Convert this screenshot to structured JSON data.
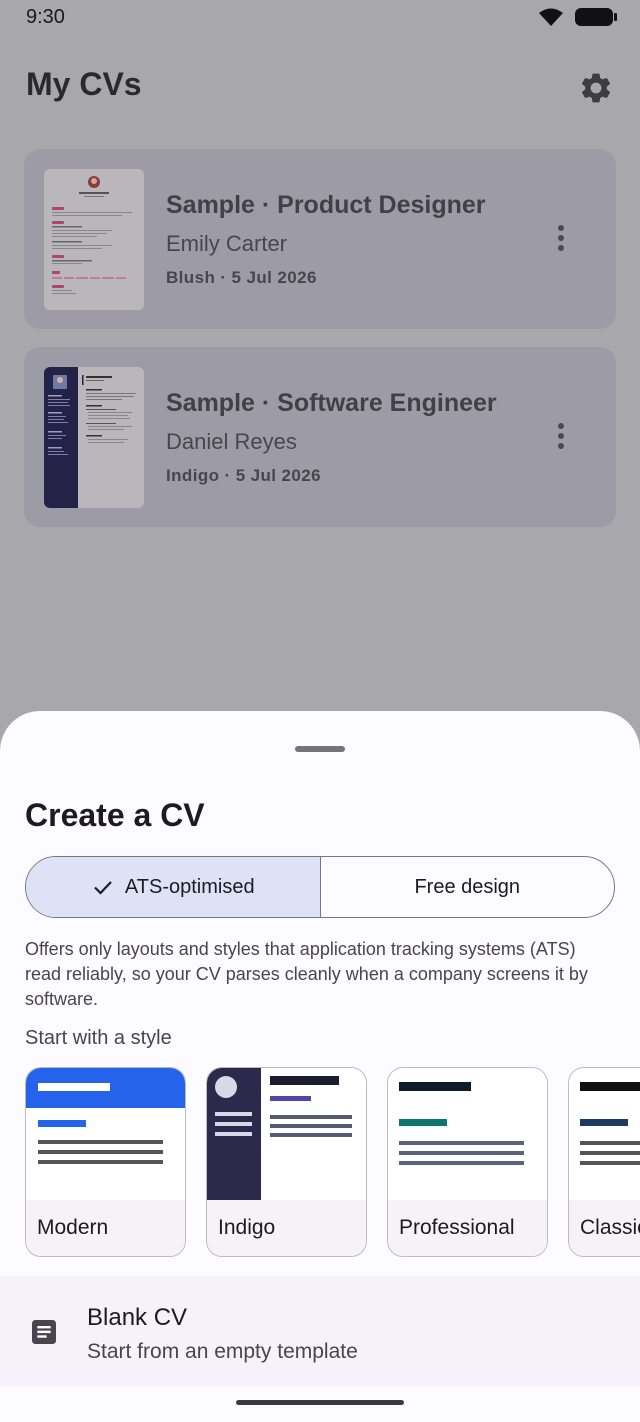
{
  "status_bar": {
    "time": "9:30"
  },
  "app_bar": {
    "title": "My CVs"
  },
  "cvs": [
    {
      "title": "Sample · Product Designer",
      "name": "Emily Carter",
      "meta": "Blush · 5 Jul 2026",
      "thumb_name": "Emily Carter"
    },
    {
      "title": "Sample · Software Engineer",
      "name": "Daniel Reyes",
      "meta": "Indigo · 5 Jul 2026",
      "thumb_name": "Daniel Reyes"
    }
  ],
  "sheet": {
    "title": "Create a CV",
    "mode_ats": "ATS-optimised",
    "mode_free": "Free design",
    "selected_mode": "ATS-optimised",
    "ats_description": "Offers only layouts and styles that application tracking systems (ATS) read reliably, so your CV parses cleanly when a company screens it by software.",
    "style_heading": "Start with a style",
    "styles": [
      {
        "label": "Modern",
        "accent": "#2563eb"
      },
      {
        "label": "Indigo",
        "accent": "#2b2a4c"
      },
      {
        "label": "Professional",
        "accent": "#0f766e"
      },
      {
        "label": "Classic",
        "accent": "#1e3a5f"
      }
    ],
    "blank": {
      "title": "Blank CV",
      "subtitle": "Start from an empty template"
    }
  }
}
